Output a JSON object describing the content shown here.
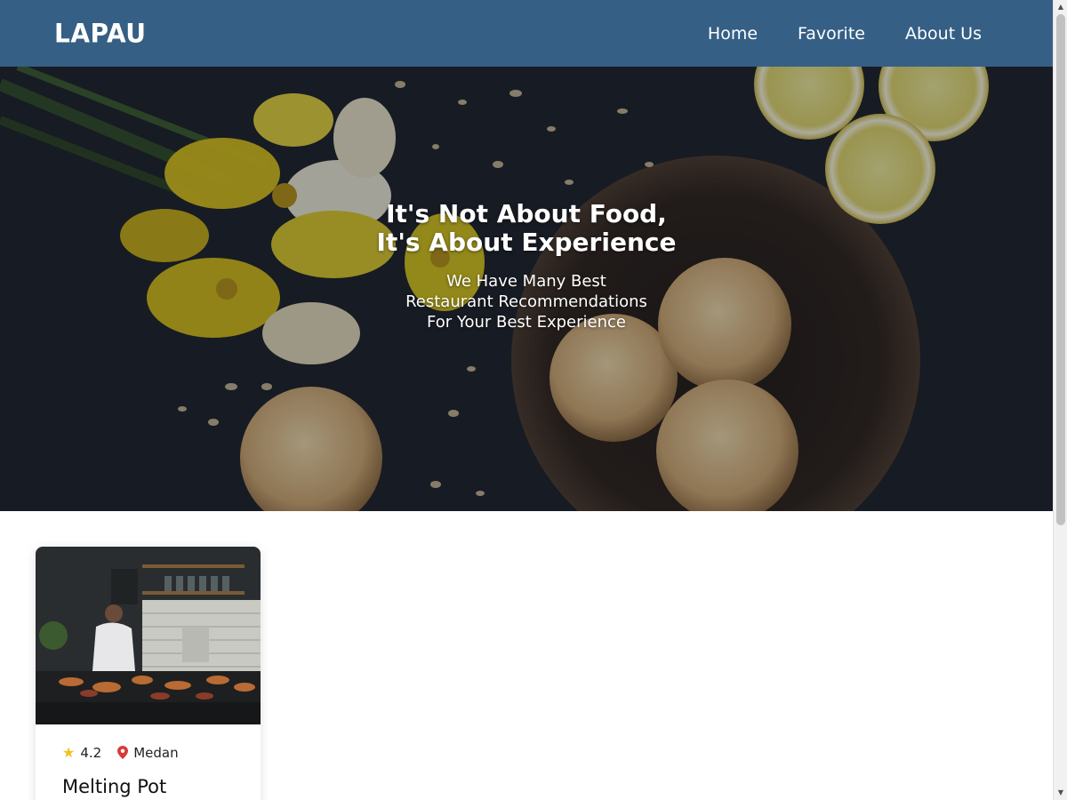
{
  "header": {
    "logo": "LAPAU",
    "nav": [
      "Home",
      "Favorite",
      "About Us"
    ]
  },
  "hero": {
    "title_line1": "It's Not About Food,",
    "title_line2": "It's About Experience",
    "subtitle_line1": "We Have Many Best",
    "subtitle_line2": "Restaurant Recommendations",
    "subtitle_line3": "For Your Best Experience"
  },
  "restaurants": [
    {
      "rating": "4.2",
      "city": "Medan",
      "name": "Melting Pot"
    }
  ],
  "colors": {
    "header_bg": "#355f85",
    "star": "#f2c21a",
    "location_pin": "#d93a3a"
  },
  "icons": {
    "rating": "star-icon",
    "location": "location-pin-icon"
  }
}
